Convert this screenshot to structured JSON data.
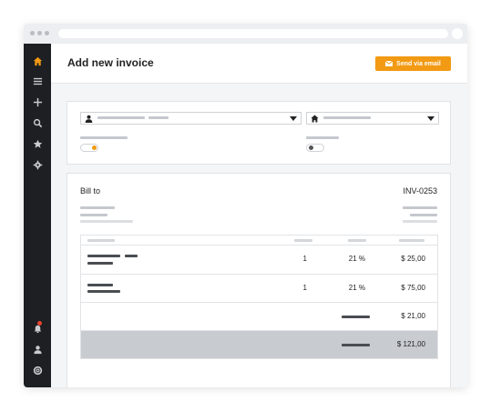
{
  "header": {
    "title": "Add new invoice",
    "send_button_label": "Send via email"
  },
  "sidebar": {
    "top_icons": [
      "home-icon",
      "menu-icon",
      "plus-icon",
      "search-icon",
      "star-icon",
      "settings-icon"
    ],
    "bottom_icons": [
      "bell-icon",
      "user-icon",
      "help-icon"
    ],
    "active_icon": "home-icon",
    "notification_badge": true
  },
  "invoice": {
    "bill_to_label": "Bill to",
    "number": "INV-0253",
    "rows": [
      {
        "quantity": "1",
        "tax": "21 %",
        "amount": "$ 25,00"
      },
      {
        "quantity": "1",
        "tax": "21 %",
        "amount": "$ 75,00"
      }
    ],
    "tax_total": "$ 21,00",
    "grand_total": "$ 121,00"
  },
  "colors": {
    "accent": "#f29a13",
    "sidebar": "#1e1f22",
    "total_row": "#c8cbd0",
    "toggle_on": "#f29a13",
    "toggle_off": "#555555"
  }
}
